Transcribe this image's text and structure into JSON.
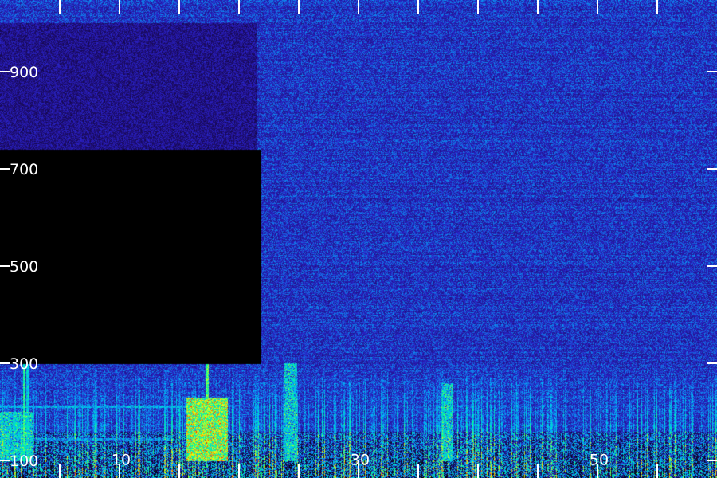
{
  "chart_data": {
    "type": "heatmap",
    "title": "",
    "xlabel": "",
    "ylabel": "",
    "x_tick_labels": [
      "10",
      "30",
      "50"
    ],
    "x_tick_values": [
      10,
      30,
      50
    ],
    "y_tick_labels": [
      "100",
      "300",
      "500",
      "700",
      "900"
    ],
    "y_tick_values": [
      100,
      300,
      500,
      700,
      900
    ],
    "xlim": [
      0,
      60
    ],
    "ylim": [
      100,
      1000
    ],
    "x_minor_step": 5,
    "colormap": [
      "#000000",
      "#1a0a5e",
      "#2a1fc4",
      "#00b7ff",
      "#00ff9a",
      "#ffff00",
      "#ff2000"
    ],
    "background_level": 0.34,
    "masked_region": {
      "x_range": [
        0,
        21.8
      ],
      "y_range": [
        300,
        740
      ],
      "level": 0.0
    },
    "dim_region": {
      "x_range": [
        0,
        21.5
      ],
      "y_range": [
        740,
        1000
      ],
      "level": 0.24
    },
    "bright_bands": [
      {
        "x_range": [
          15.6,
          19.0
        ],
        "y_range": [
          100,
          230
        ],
        "level": 0.75
      },
      {
        "x_range": [
          23.8,
          24.8
        ],
        "y_range": [
          100,
          300
        ],
        "level": 0.55
      },
      {
        "x_range": [
          36.9,
          37.9
        ],
        "y_range": [
          100,
          260
        ],
        "level": 0.55
      },
      {
        "x_range": [
          0,
          2.8
        ],
        "y_range": [
          100,
          200
        ],
        "level": 0.55
      }
    ],
    "vertical_lines": [
      {
        "x": 2.0,
        "y_range": [
          100,
          300
        ],
        "level": 0.65
      },
      {
        "x": 2.3,
        "y_range": [
          100,
          300
        ],
        "level": 0.55
      },
      {
        "x": 17.3,
        "y_range": [
          100,
          320
        ],
        "level": 0.7
      }
    ],
    "horizontal_lines": [
      {
        "y": 212,
        "x_range": [
          0,
          15.5
        ],
        "level": 0.5
      },
      {
        "y": 145,
        "x_range": [
          0,
          14.5
        ],
        "level": 0.45
      }
    ],
    "grid": false,
    "legend": "none"
  }
}
